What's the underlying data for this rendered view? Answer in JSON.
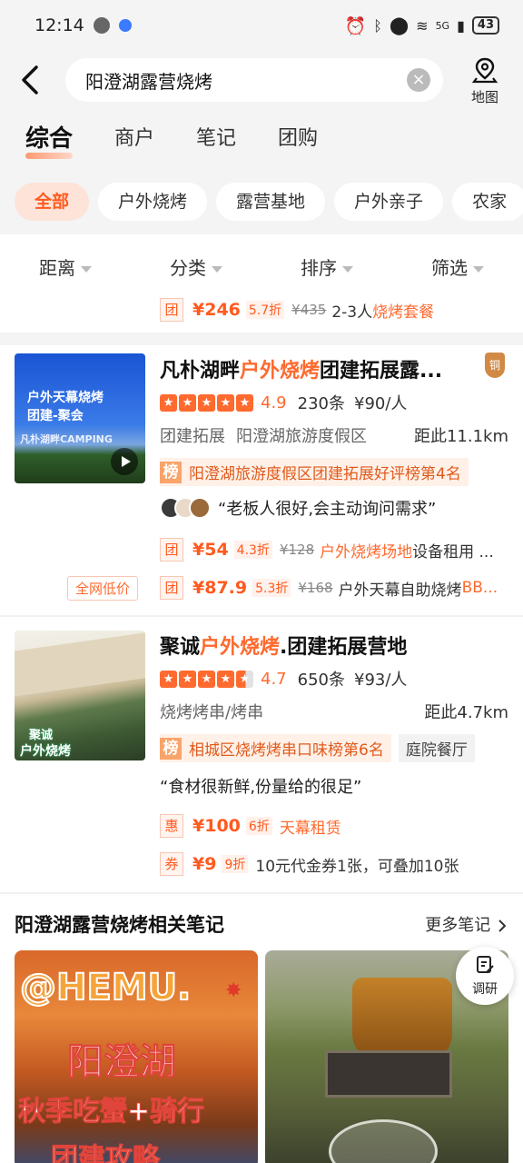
{
  "status": {
    "time": "12:14",
    "battery": "43",
    "network": "5G"
  },
  "search": {
    "query": "阳澄湖露营烧烤",
    "map_label": "地图"
  },
  "tabs": [
    "综合",
    "商户",
    "笔记",
    "团购"
  ],
  "chips": [
    "全部",
    "户外烧烤",
    "露营基地",
    "户外亲子",
    "农家"
  ],
  "filters": [
    "距离",
    "分类",
    "排序",
    "筛选"
  ],
  "top_deal": {
    "tag": "团",
    "price": "¥246",
    "discount": "5.7折",
    "original": "¥435",
    "text_plain": "2-3人",
    "text_hl": "烧烤套餐"
  },
  "cards": [
    {
      "title_a": "凡朴湖畔",
      "title_hl": "户外烧烤",
      "title_b": "团建拓展露...",
      "badge": "铜",
      "thumb_text1": "户外天幕烧烤",
      "thumb_text2": "团建-聚会",
      "thumb_text3": "凡朴湖畔CAMPING",
      "stars": "5",
      "score": "4.9",
      "reviews": "230条",
      "avg": "¥90/人",
      "category": "团建拓展",
      "area": "阳澄湖旅游度假区",
      "distance": "距此11.1km",
      "rank_badge": "榜",
      "rank": "阳澄湖旅游度假区团建拓展好评榜第4名",
      "review": "“老板人很好,会主动询问需求”",
      "low_label": "全网低价",
      "deals": [
        {
          "tag": "团",
          "price": "¥54",
          "discount": "4.3折",
          "original": "¥128",
          "hl": "户外烧烤场地",
          "text": "设备租用 ..."
        },
        {
          "tag": "团",
          "price": "¥87.9",
          "discount": "5.3折",
          "original": "¥168",
          "text": "户外天幕自助烧烤",
          "hl": "BB..."
        }
      ]
    },
    {
      "title_a": "聚诚",
      "title_hl": "户外烧烤",
      "title_b": ".团建拓展营地",
      "thumb_text1": "聚诚",
      "thumb_text2": "户外烧烤",
      "stars": "4.5",
      "score": "4.7",
      "reviews": "650条",
      "avg": "¥93/人",
      "category": "烧烤烤串/烤串",
      "distance": "距此4.7km",
      "rank_badge": "榜",
      "rank": "相城区烧烤烤串口味榜第6名",
      "tag": "庭院餐厅",
      "review": "“食材很新鲜,份量给的很足”",
      "deals": [
        {
          "tag": "惠",
          "price": "¥100",
          "discount": "6折",
          "hl": "天幕租赁"
        },
        {
          "tag": "券",
          "price": "¥9",
          "discount": "9折",
          "text": "10元代金券1张，可叠加10张"
        }
      ]
    }
  ],
  "notes": {
    "title": "阳澄湖露营烧烤相关笔记",
    "more": "更多笔记",
    "note1_lines": [
      "@HEMU.",
      "阳澄湖",
      "秋季吃蟹+骑行",
      "团建攻略"
    ],
    "fab_label": "调研"
  },
  "colors": {
    "accent": "#ff5a1f",
    "background": "#f4f4f4"
  }
}
